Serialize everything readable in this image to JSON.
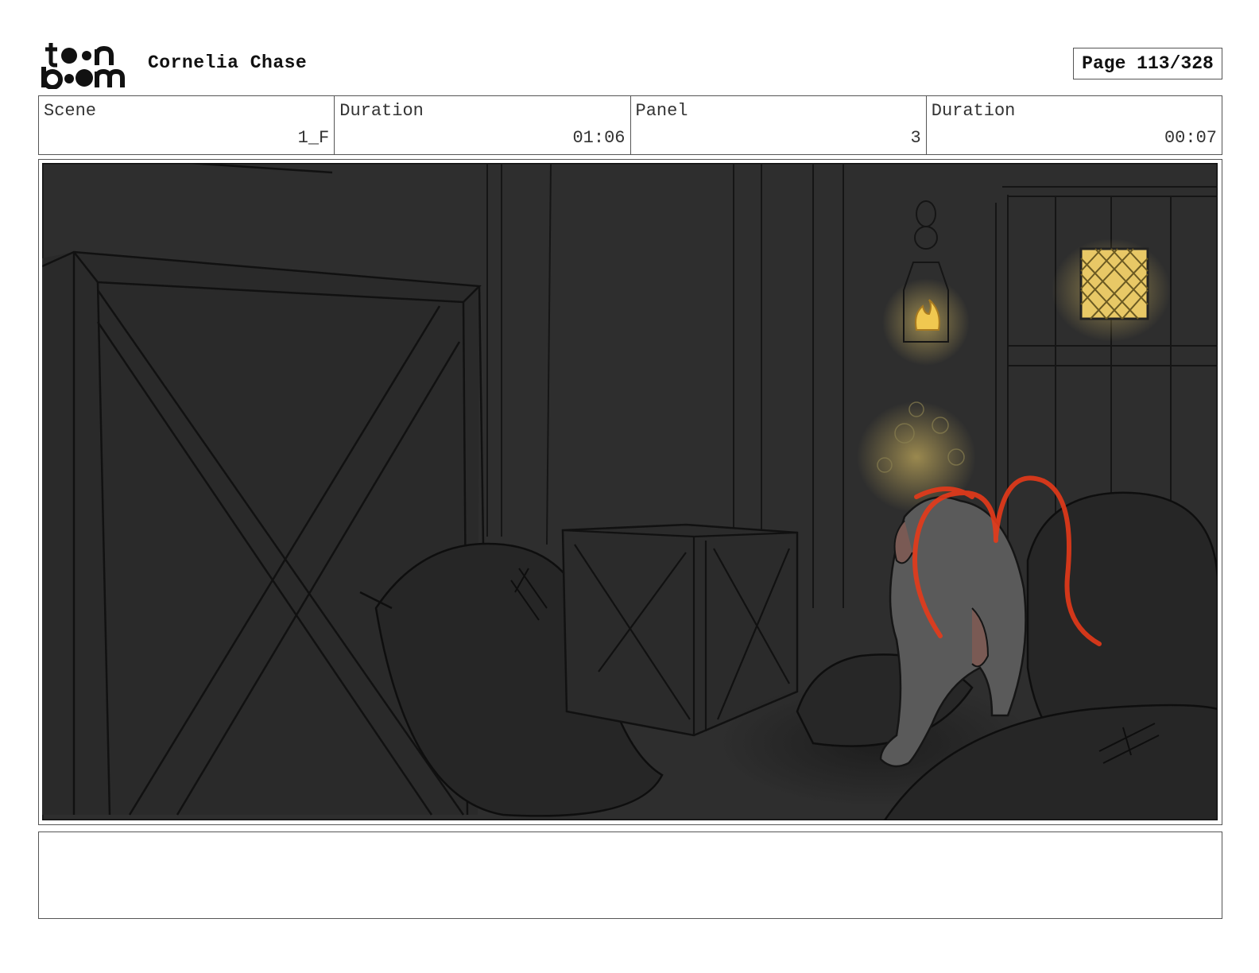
{
  "header": {
    "logo_text": "toon boom",
    "project_title": "Cornelia Chase",
    "page_label": "Page 113/328"
  },
  "info": {
    "scene_label": "Scene",
    "scene_value": "1_F",
    "scene_duration_label": "Duration",
    "scene_duration_value": "01:06",
    "panel_label": "Panel",
    "panel_value": "3",
    "panel_duration_label": "Duration",
    "panel_duration_value": "00:07"
  },
  "notes": {
    "text": ""
  }
}
